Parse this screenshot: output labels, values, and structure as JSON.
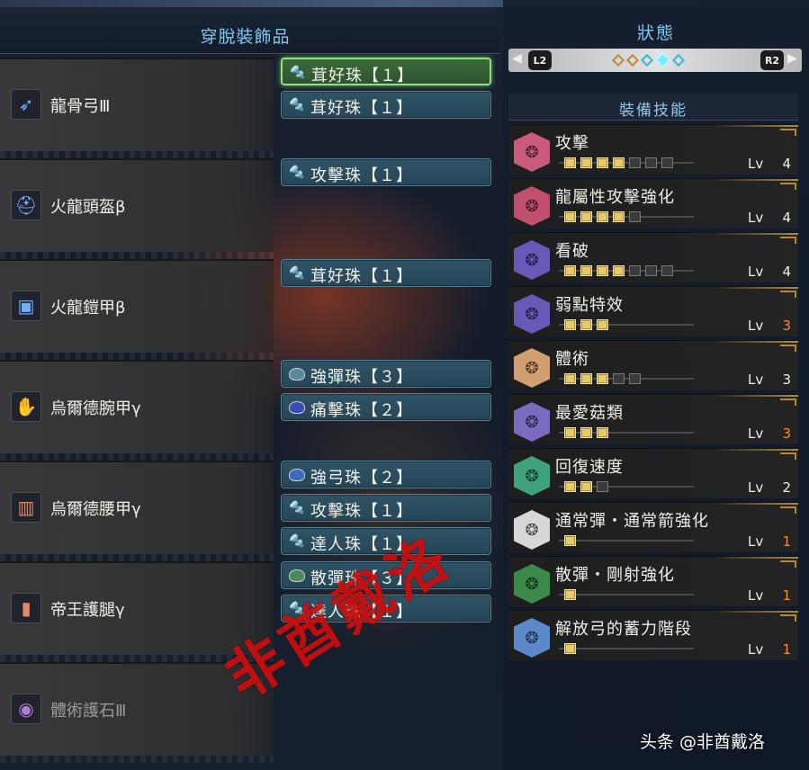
{
  "left_panel": {
    "title": "穿脫裝飾品",
    "equipment": [
      {
        "name": "龍骨弓Ⅲ",
        "icon": "bow-icon",
        "decorations": [
          {
            "label": "茸好珠【１】",
            "icon": "gem-lv1-icon",
            "selected": true
          },
          {
            "label": "茸好珠【１】",
            "icon": "gem-lv1-icon",
            "selected": false
          }
        ]
      },
      {
        "name": "火龍頭盔β",
        "icon": "helmet-icon",
        "decorations": [
          {
            "label": "攻擊珠【１】",
            "icon": "gem-lv1-icon"
          }
        ]
      },
      {
        "name": "火龍鎧甲β",
        "icon": "chest-armor-icon",
        "decorations": [
          {
            "label": "茸好珠【１】",
            "icon": "gem-lv1-icon"
          }
        ]
      },
      {
        "name": "烏爾德腕甲γ",
        "icon": "gauntlet-icon",
        "decorations": [
          {
            "label": "強彈珠【３】",
            "icon": "gem-lv3-icon"
          },
          {
            "label": "痛擊珠【２】",
            "icon": "gem-lv2-icon"
          }
        ]
      },
      {
        "name": "烏爾德腰甲γ",
        "icon": "waist-armor-icon",
        "decorations": [
          {
            "label": "強弓珠【２】",
            "icon": "gem-lv2-icon"
          },
          {
            "label": "攻擊珠【１】",
            "icon": "gem-lv1-icon"
          },
          {
            "label": "達人珠【１】",
            "icon": "gem-lv1-icon"
          }
        ]
      },
      {
        "name": "帝王護腿γ",
        "icon": "leg-armor-icon",
        "decorations": [
          {
            "label": "散彈珠【３】",
            "icon": "gem-lv3-icon"
          },
          {
            "label": "達人珠【１】",
            "icon": "gem-lv1-icon"
          }
        ]
      },
      {
        "name": "體術護石Ⅲ",
        "icon": "charm-icon",
        "decorations": []
      }
    ],
    "watermark_stamp": "非酋戴洛"
  },
  "right_panel": {
    "title": "狀態",
    "nav": {
      "left_key": "L2",
      "right_key": "R2",
      "left_arrow": "◀",
      "right_arrow": "▶",
      "page_count": 5,
      "active_page": 4
    },
    "skills_title": "裝備技能",
    "lv_label": "Lv",
    "skills": [
      {
        "name": "攻擊",
        "level": "4",
        "max": 7,
        "level_color": "white",
        "icon_color": "#c85a7a"
      },
      {
        "name": "龍屬性攻擊強化",
        "level": "4",
        "max": 5,
        "level_color": "white",
        "icon_color": "#c0506e"
      },
      {
        "name": "看破",
        "level": "4",
        "max": 7,
        "level_color": "white",
        "icon_color": "#6a58b8"
      },
      {
        "name": "弱點特效",
        "level": "3",
        "max": 3,
        "level_color": "orange",
        "icon_color": "#6a58b8"
      },
      {
        "name": "體術",
        "level": "3",
        "max": 5,
        "level_color": "white",
        "icon_color": "#d2a070"
      },
      {
        "name": "最愛菇類",
        "level": "3",
        "max": 3,
        "level_color": "orange",
        "icon_color": "#7a6ac0"
      },
      {
        "name": "回復速度",
        "level": "2",
        "max": 3,
        "level_color": "white",
        "icon_color": "#3ea37a"
      },
      {
        "name": "通常彈・通常箭強化",
        "level": "1",
        "max": 1,
        "level_color": "orange",
        "icon_color": "#d8d8d8"
      },
      {
        "name": "散彈・剛射強化",
        "level": "1",
        "max": 1,
        "level_color": "orange",
        "icon_color": "#3a8a4a"
      },
      {
        "name": "解放弓的蓄力階段",
        "level": "1",
        "max": 1,
        "level_color": "orange",
        "icon_color": "#5a88c8"
      }
    ]
  },
  "source_credit": "头条 @非酋戴洛",
  "colors": {
    "accent_title": "#7fc6ec",
    "pip_on": "#e6c96a",
    "level_max": "#ff8a2a",
    "slot_selected": "#8fe37a"
  }
}
